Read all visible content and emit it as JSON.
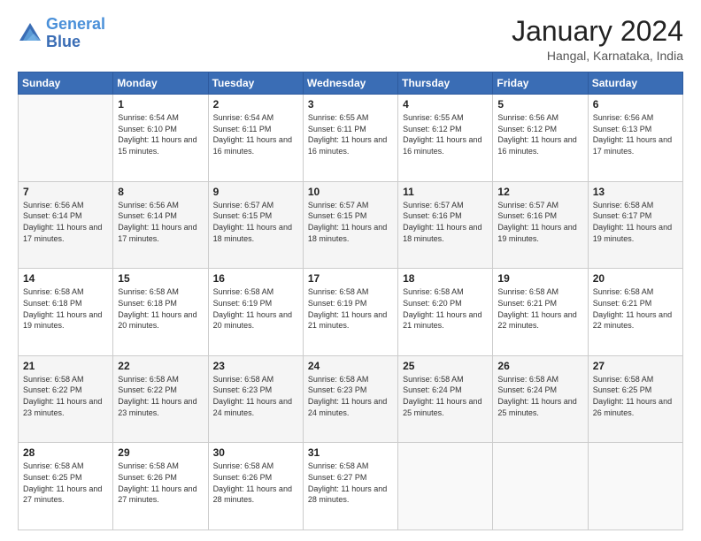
{
  "header": {
    "logo": {
      "line1": "General",
      "line2": "Blue"
    },
    "title": "January 2024",
    "subtitle": "Hangal, Karnataka, India"
  },
  "weekdays": [
    "Sunday",
    "Monday",
    "Tuesday",
    "Wednesday",
    "Thursday",
    "Friday",
    "Saturday"
  ],
  "weeks": [
    [
      {
        "day": "",
        "sunrise": "",
        "sunset": "",
        "daylight": ""
      },
      {
        "day": "1",
        "sunrise": "Sunrise: 6:54 AM",
        "sunset": "Sunset: 6:10 PM",
        "daylight": "Daylight: 11 hours and 15 minutes."
      },
      {
        "day": "2",
        "sunrise": "Sunrise: 6:54 AM",
        "sunset": "Sunset: 6:11 PM",
        "daylight": "Daylight: 11 hours and 16 minutes."
      },
      {
        "day": "3",
        "sunrise": "Sunrise: 6:55 AM",
        "sunset": "Sunset: 6:11 PM",
        "daylight": "Daylight: 11 hours and 16 minutes."
      },
      {
        "day": "4",
        "sunrise": "Sunrise: 6:55 AM",
        "sunset": "Sunset: 6:12 PM",
        "daylight": "Daylight: 11 hours and 16 minutes."
      },
      {
        "day": "5",
        "sunrise": "Sunrise: 6:56 AM",
        "sunset": "Sunset: 6:12 PM",
        "daylight": "Daylight: 11 hours and 16 minutes."
      },
      {
        "day": "6",
        "sunrise": "Sunrise: 6:56 AM",
        "sunset": "Sunset: 6:13 PM",
        "daylight": "Daylight: 11 hours and 17 minutes."
      }
    ],
    [
      {
        "day": "7",
        "sunrise": "Sunrise: 6:56 AM",
        "sunset": "Sunset: 6:14 PM",
        "daylight": "Daylight: 11 hours and 17 minutes."
      },
      {
        "day": "8",
        "sunrise": "Sunrise: 6:56 AM",
        "sunset": "Sunset: 6:14 PM",
        "daylight": "Daylight: 11 hours and 17 minutes."
      },
      {
        "day": "9",
        "sunrise": "Sunrise: 6:57 AM",
        "sunset": "Sunset: 6:15 PM",
        "daylight": "Daylight: 11 hours and 18 minutes."
      },
      {
        "day": "10",
        "sunrise": "Sunrise: 6:57 AM",
        "sunset": "Sunset: 6:15 PM",
        "daylight": "Daylight: 11 hours and 18 minutes."
      },
      {
        "day": "11",
        "sunrise": "Sunrise: 6:57 AM",
        "sunset": "Sunset: 6:16 PM",
        "daylight": "Daylight: 11 hours and 18 minutes."
      },
      {
        "day": "12",
        "sunrise": "Sunrise: 6:57 AM",
        "sunset": "Sunset: 6:16 PM",
        "daylight": "Daylight: 11 hours and 19 minutes."
      },
      {
        "day": "13",
        "sunrise": "Sunrise: 6:58 AM",
        "sunset": "Sunset: 6:17 PM",
        "daylight": "Daylight: 11 hours and 19 minutes."
      }
    ],
    [
      {
        "day": "14",
        "sunrise": "Sunrise: 6:58 AM",
        "sunset": "Sunset: 6:18 PM",
        "daylight": "Daylight: 11 hours and 19 minutes."
      },
      {
        "day": "15",
        "sunrise": "Sunrise: 6:58 AM",
        "sunset": "Sunset: 6:18 PM",
        "daylight": "Daylight: 11 hours and 20 minutes."
      },
      {
        "day": "16",
        "sunrise": "Sunrise: 6:58 AM",
        "sunset": "Sunset: 6:19 PM",
        "daylight": "Daylight: 11 hours and 20 minutes."
      },
      {
        "day": "17",
        "sunrise": "Sunrise: 6:58 AM",
        "sunset": "Sunset: 6:19 PM",
        "daylight": "Daylight: 11 hours and 21 minutes."
      },
      {
        "day": "18",
        "sunrise": "Sunrise: 6:58 AM",
        "sunset": "Sunset: 6:20 PM",
        "daylight": "Daylight: 11 hours and 21 minutes."
      },
      {
        "day": "19",
        "sunrise": "Sunrise: 6:58 AM",
        "sunset": "Sunset: 6:21 PM",
        "daylight": "Daylight: 11 hours and 22 minutes."
      },
      {
        "day": "20",
        "sunrise": "Sunrise: 6:58 AM",
        "sunset": "Sunset: 6:21 PM",
        "daylight": "Daylight: 11 hours and 22 minutes."
      }
    ],
    [
      {
        "day": "21",
        "sunrise": "Sunrise: 6:58 AM",
        "sunset": "Sunset: 6:22 PM",
        "daylight": "Daylight: 11 hours and 23 minutes."
      },
      {
        "day": "22",
        "sunrise": "Sunrise: 6:58 AM",
        "sunset": "Sunset: 6:22 PM",
        "daylight": "Daylight: 11 hours and 23 minutes."
      },
      {
        "day": "23",
        "sunrise": "Sunrise: 6:58 AM",
        "sunset": "Sunset: 6:23 PM",
        "daylight": "Daylight: 11 hours and 24 minutes."
      },
      {
        "day": "24",
        "sunrise": "Sunrise: 6:58 AM",
        "sunset": "Sunset: 6:23 PM",
        "daylight": "Daylight: 11 hours and 24 minutes."
      },
      {
        "day": "25",
        "sunrise": "Sunrise: 6:58 AM",
        "sunset": "Sunset: 6:24 PM",
        "daylight": "Daylight: 11 hours and 25 minutes."
      },
      {
        "day": "26",
        "sunrise": "Sunrise: 6:58 AM",
        "sunset": "Sunset: 6:24 PM",
        "daylight": "Daylight: 11 hours and 25 minutes."
      },
      {
        "day": "27",
        "sunrise": "Sunrise: 6:58 AM",
        "sunset": "Sunset: 6:25 PM",
        "daylight": "Daylight: 11 hours and 26 minutes."
      }
    ],
    [
      {
        "day": "28",
        "sunrise": "Sunrise: 6:58 AM",
        "sunset": "Sunset: 6:25 PM",
        "daylight": "Daylight: 11 hours and 27 minutes."
      },
      {
        "day": "29",
        "sunrise": "Sunrise: 6:58 AM",
        "sunset": "Sunset: 6:26 PM",
        "daylight": "Daylight: 11 hours and 27 minutes."
      },
      {
        "day": "30",
        "sunrise": "Sunrise: 6:58 AM",
        "sunset": "Sunset: 6:26 PM",
        "daylight": "Daylight: 11 hours and 28 minutes."
      },
      {
        "day": "31",
        "sunrise": "Sunrise: 6:58 AM",
        "sunset": "Sunset: 6:27 PM",
        "daylight": "Daylight: 11 hours and 28 minutes."
      },
      {
        "day": "",
        "sunrise": "",
        "sunset": "",
        "daylight": ""
      },
      {
        "day": "",
        "sunrise": "",
        "sunset": "",
        "daylight": ""
      },
      {
        "day": "",
        "sunrise": "",
        "sunset": "",
        "daylight": ""
      }
    ]
  ]
}
